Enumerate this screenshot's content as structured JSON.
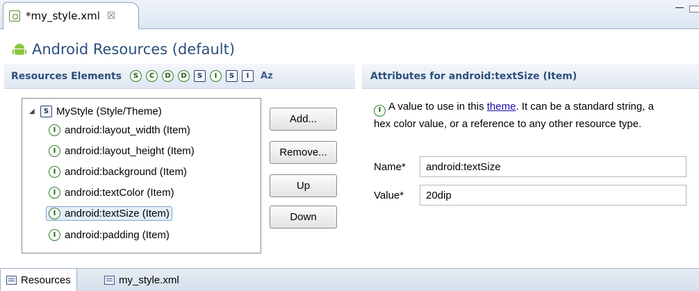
{
  "editor_tab": {
    "title": "*my_style.xml",
    "close_glyph": "☒"
  },
  "header": {
    "title": "Android Resources (default)"
  },
  "resources_section": {
    "title": "Resources Elements",
    "toolbar": [
      {
        "letter": "S",
        "shape": "circle"
      },
      {
        "letter": "C",
        "shape": "circle"
      },
      {
        "letter": "D",
        "shape": "circle"
      },
      {
        "letter": "D",
        "shape": "circle"
      },
      {
        "letter": "S",
        "shape": "square"
      },
      {
        "letter": "I",
        "shape": "circle"
      },
      {
        "letter": "S",
        "shape": "square"
      },
      {
        "letter": "I",
        "shape": "square"
      }
    ],
    "sort_label": "Az"
  },
  "tree": {
    "root": {
      "icon": "S",
      "label": "MyStyle (Style/Theme)"
    },
    "items": [
      {
        "icon": "I",
        "label": "android:layout_width (Item)"
      },
      {
        "icon": "I",
        "label": "android:layout_height (Item)"
      },
      {
        "icon": "I",
        "label": "android:background (Item)"
      },
      {
        "icon": "I",
        "label": "android:textColor (Item)"
      },
      {
        "icon": "I",
        "label": "android:textSize (Item)",
        "selected": true
      },
      {
        "icon": "I",
        "label": "android:padding (Item)"
      }
    ]
  },
  "buttons": {
    "add": "Add...",
    "remove": "Remove...",
    "up": "Up",
    "down": "Down"
  },
  "attributes_section": {
    "title": "Attributes for android:textSize (Item)",
    "desc_before": "A value to use in this ",
    "desc_link": "theme",
    "desc_after": ". It can be a standard string, a hex color value, or a reference to any other resource type.",
    "name_label": "Name*",
    "name_value": "android:textSize",
    "value_label": "Value*",
    "value_value": "20dip"
  },
  "bottom_tabs": [
    {
      "label": "Resources",
      "active": true
    },
    {
      "label": "my_style.xml",
      "active": false
    }
  ]
}
